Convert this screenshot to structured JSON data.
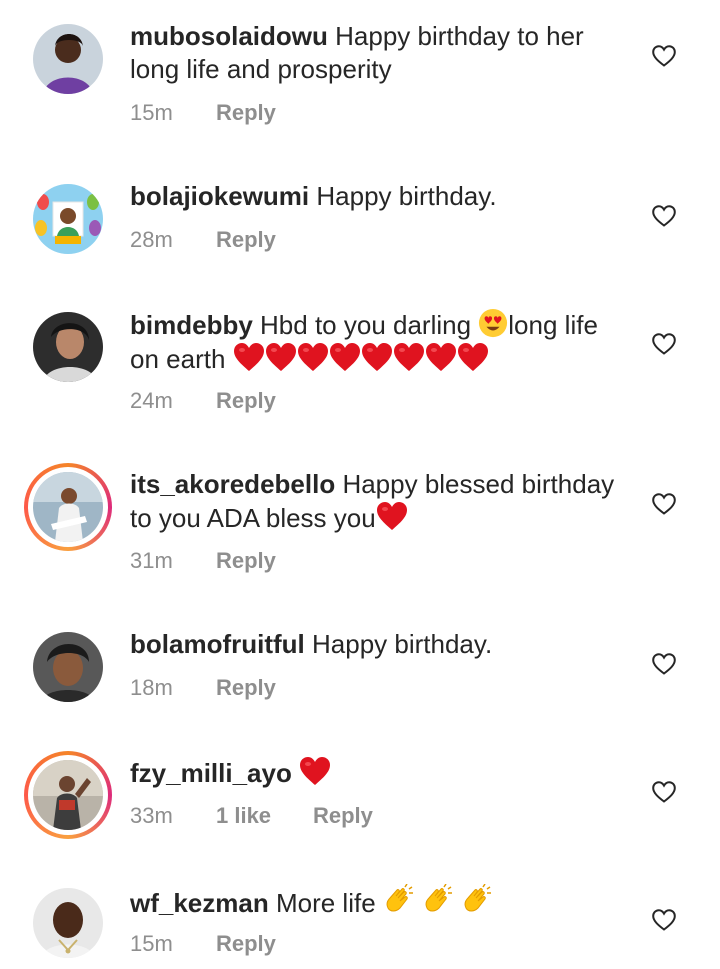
{
  "comments": [
    {
      "username": "mubosolaidowu",
      "text": "Happy birthday to her long life and prosperity",
      "time": "15m",
      "likes": "",
      "reply_label": "Reply"
    },
    {
      "username": "bolajiokewumi",
      "text": "Happy birthday.",
      "time": "28m",
      "likes": "",
      "reply_label": "Reply"
    },
    {
      "username": "bimdebby",
      "text_before_emoji": "Hbd to you darling ",
      "text_after_emoji": "long life on earth ",
      "time": "24m",
      "likes": "",
      "reply_label": "Reply"
    },
    {
      "username": "its_akoredebello",
      "text": "Happy blessed birthday to you ADA bless you",
      "time": "31m",
      "likes": "",
      "reply_label": "Reply"
    },
    {
      "username": "bolamofruitful",
      "text": "Happy birthday.",
      "time": "18m",
      "likes": "",
      "reply_label": "Reply"
    },
    {
      "username": "fzy_milli_ayo",
      "text": "",
      "time": "33m",
      "likes": "1 like",
      "reply_label": "Reply"
    },
    {
      "username": "wf_kezman",
      "text": "More life ",
      "time": "15m",
      "likes": "",
      "reply_label": "Reply"
    }
  ],
  "icons": {
    "like": "heart-outline-icon",
    "red_heart": "red-heart-emoji",
    "heart_eyes": "heart-eyes-emoji",
    "clap": "clapping-hands-emoji"
  },
  "colors": {
    "text": "#262626",
    "meta": "#8e8e8e",
    "heart": "#e0131f",
    "story_ring": "#dd2a7b"
  }
}
